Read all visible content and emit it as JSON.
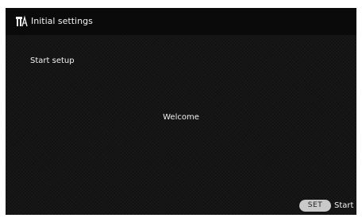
{
  "header": {
    "icon": "initial-settings-icon",
    "title": "Initial settings"
  },
  "main": {
    "menu_item": "Start setup",
    "message": "Welcome"
  },
  "footer": {
    "set_button_label": "SET",
    "action_label": "Start"
  },
  "colors": {
    "background": "#151515",
    "header_background": "#0a0a0a",
    "text": "#f2f2f2",
    "button": "#c9c9c9"
  }
}
